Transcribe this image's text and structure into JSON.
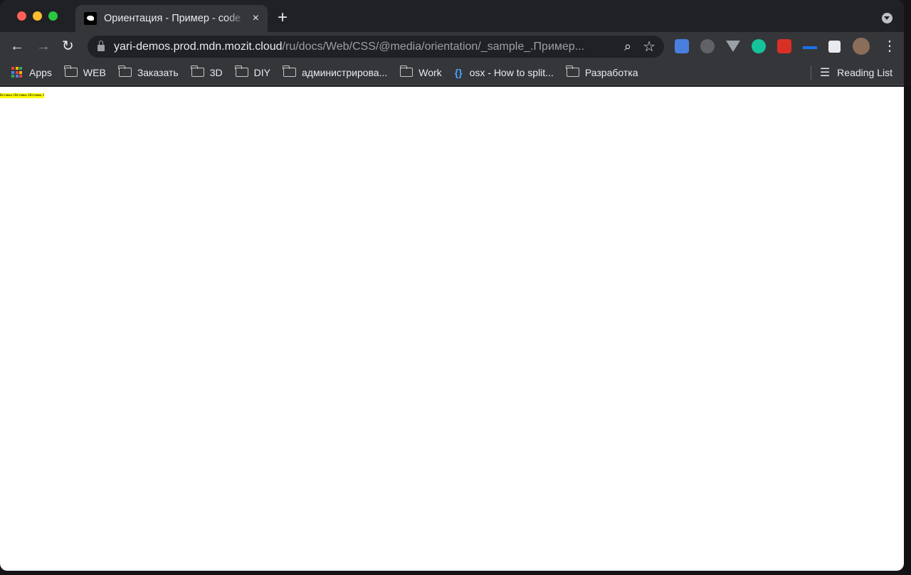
{
  "tab": {
    "title": "Ориентация - Пример - code",
    "close": "×",
    "new_tab": "+"
  },
  "toolbar": {
    "back": "←",
    "forward": "→",
    "reload": "↻",
    "url_host": "yari-demos.prod.mdn.mozit.cloud",
    "url_path": "/ru/docs/Web/CSS/@media/orientation/_sample_.Пример...",
    "zoom": "⌕",
    "star": "☆",
    "menu": "⋮"
  },
  "bookmarks": {
    "items": [
      {
        "label": "Apps"
      },
      {
        "label": "WEB"
      },
      {
        "label": "Заказать"
      },
      {
        "label": "3D"
      },
      {
        "label": "DIY"
      },
      {
        "label": "администрирова..."
      },
      {
        "label": "Work"
      },
      {
        "label": "osx - How to split..."
      },
      {
        "label": "Разработка"
      }
    ],
    "reading_list": "Reading List"
  },
  "content": {
    "boxes": [
      "Вставка 1",
      "Вставка 2",
      "Вставка 3"
    ],
    "highlight_color": "#ffff00"
  }
}
